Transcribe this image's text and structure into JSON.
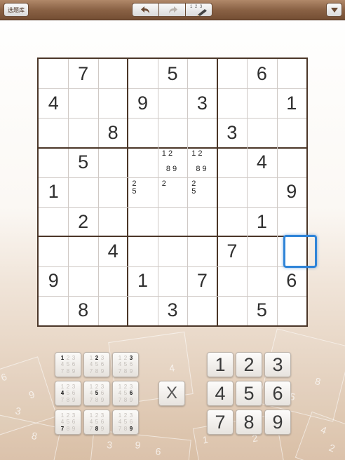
{
  "toolbar": {
    "back_label": "选题库",
    "undo_icon": "undo-arrow-icon",
    "redo_icon": "redo-arrow-icon",
    "notes_digits": "1 2 3",
    "notes_icon": "pencil-icon",
    "menu_icon": "triangle-down-icon"
  },
  "board": {
    "cells": [
      [
        "",
        "7",
        "",
        "",
        "5",
        "",
        "",
        "6",
        ""
      ],
      [
        "4",
        "",
        "",
        "9",
        "",
        "3",
        "",
        "",
        "1"
      ],
      [
        "",
        "",
        "8",
        "",
        "",
        "",
        "3",
        "",
        ""
      ],
      [
        "",
        "5",
        "",
        "",
        "",
        "",
        "",
        "4",
        ""
      ],
      [
        "1",
        "",
        "",
        "",
        "",
        "",
        "",
        "",
        "9"
      ],
      [
        "",
        "2",
        "",
        "",
        "",
        "",
        "",
        "1",
        ""
      ],
      [
        "",
        "",
        "4",
        "",
        "",
        "",
        "7",
        "",
        ""
      ],
      [
        "9",
        "",
        "",
        "1",
        "",
        "7",
        "",
        "",
        "6"
      ],
      [
        "",
        "8",
        "",
        "",
        "3",
        "",
        "",
        "5",
        ""
      ]
    ],
    "pencil_marks": {
      "r3c4": "1 2\n\n  8 9",
      "r3c5": "1 2\n\n  8 9",
      "r4c3": "2\n5",
      "r4c4": "2",
      "r4c5": "2\n5"
    },
    "selected": {
      "row": 4,
      "col": 7
    }
  },
  "pencil_pad": [
    "1",
    "2",
    "3",
    "4",
    "5",
    "6",
    "7",
    "8",
    "9"
  ],
  "pencil_pad_digits": [
    "1",
    "2",
    "3",
    "4",
    "5",
    "6",
    "7",
    "8",
    "9"
  ],
  "erase_label": "X",
  "number_pad": [
    "1",
    "2",
    "3",
    "4",
    "5",
    "6",
    "7",
    "8",
    "9"
  ],
  "colors": {
    "toolbar": "#8a6245",
    "grid_thick": "#4b3628",
    "selection": "#2f84d8"
  }
}
